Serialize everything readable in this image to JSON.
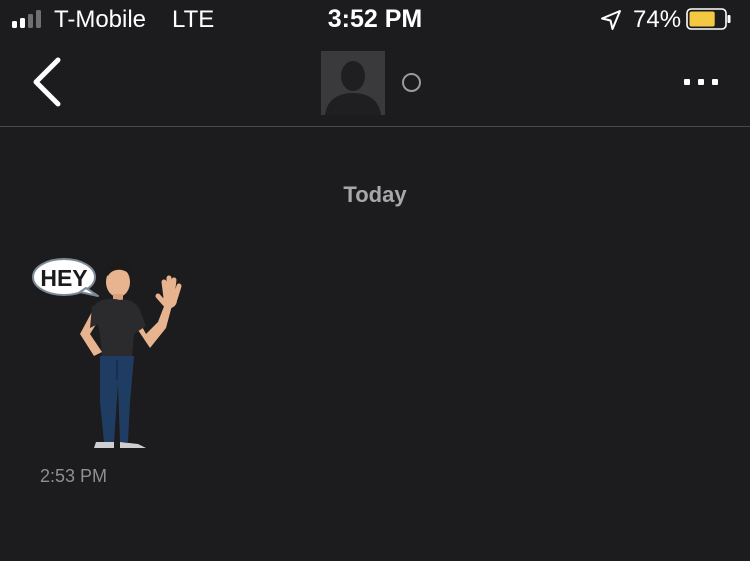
{
  "status_bar": {
    "carrier": "T-Mobile",
    "network": "LTE",
    "time": "3:52 PM",
    "battery_percent": "74%",
    "battery_level": 0.74,
    "signal_bars_filled": 2,
    "signal_bars_total": 4,
    "icons": [
      "signal-icon",
      "location-arrow-icon",
      "battery-icon"
    ]
  },
  "nav": {
    "icons": [
      "back-chevron-icon",
      "avatar-placeholder-icon",
      "presence-circle-icon",
      "more-dots-icon"
    ]
  },
  "chat": {
    "day_label": "Today",
    "messages": [
      {
        "type": "sticker",
        "sticker_text": "HEY",
        "time": "2:53 PM"
      }
    ]
  },
  "colors": {
    "background": "#1c1c1e",
    "battery_fill": "#f5c842",
    "divider": "#4a4a4c",
    "muted_text": "#8e8e93"
  }
}
